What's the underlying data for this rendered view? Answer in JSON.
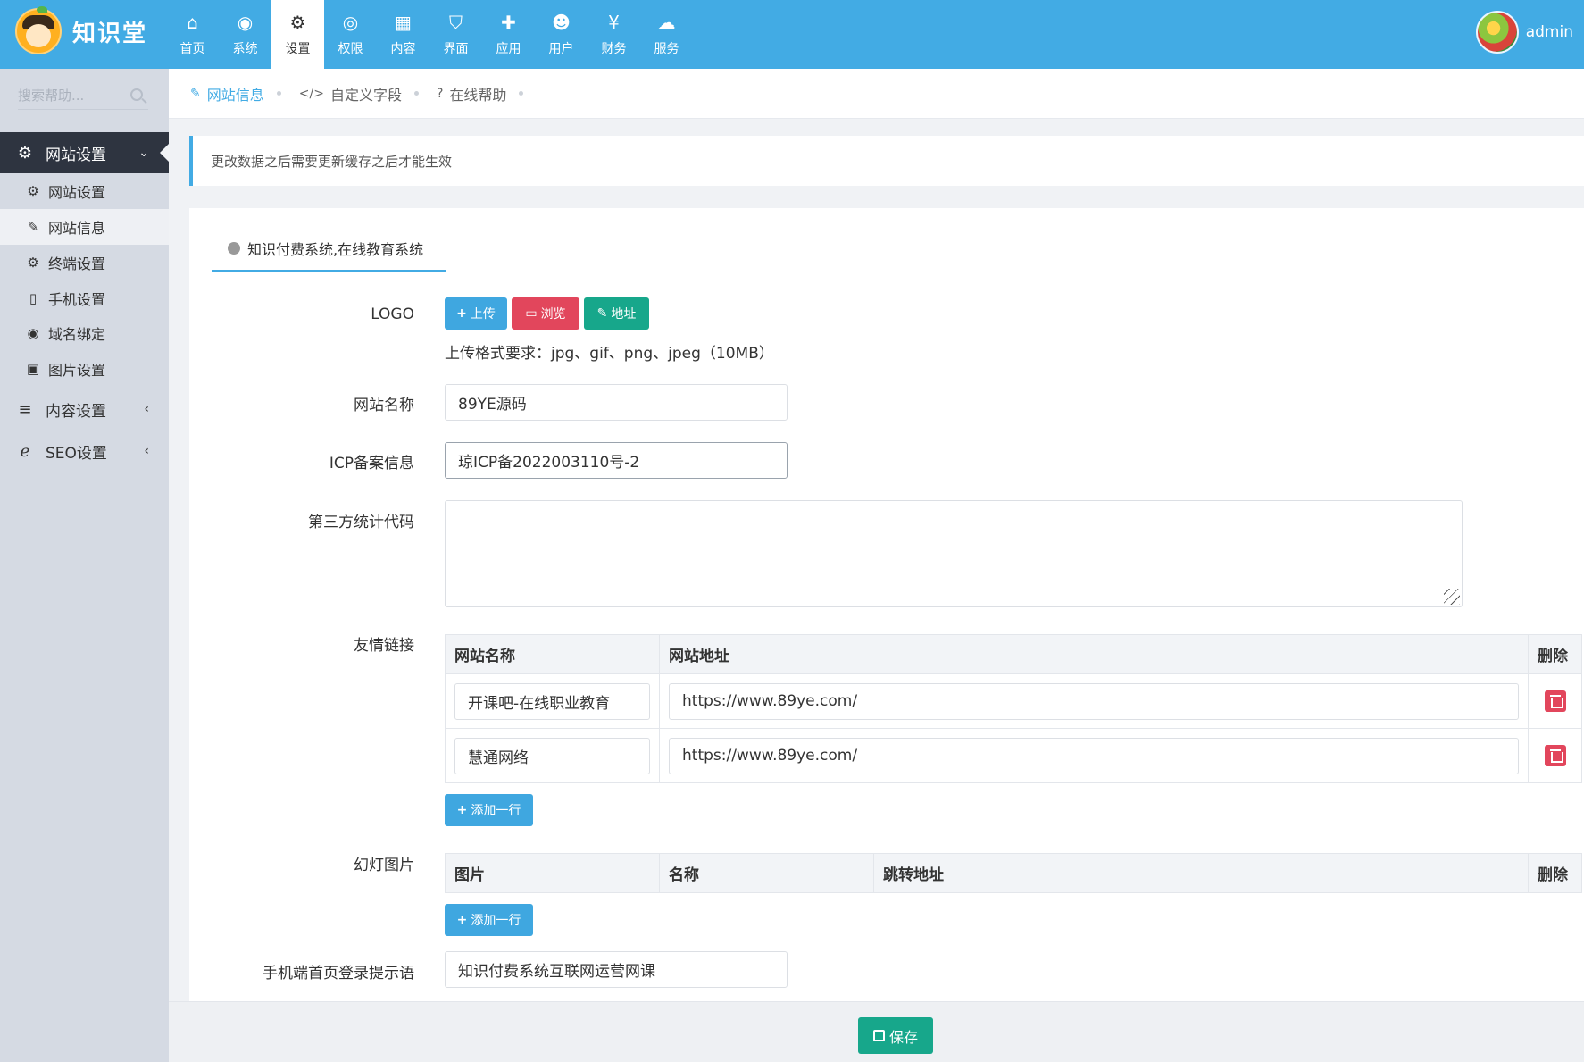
{
  "brand": {
    "name": "知识堂"
  },
  "topnav": [
    {
      "label": "首页",
      "icon": "home-icon",
      "glyph": "⌂"
    },
    {
      "label": "系统",
      "icon": "globe-icon",
      "glyph": "◉"
    },
    {
      "label": "设置",
      "icon": "gears-icon",
      "glyph": "⚙",
      "active": true
    },
    {
      "label": "权限",
      "icon": "user-circle-icon",
      "glyph": "◎"
    },
    {
      "label": "内容",
      "icon": "grid-icon",
      "glyph": "▦"
    },
    {
      "label": "界面",
      "icon": "html5-icon",
      "glyph": "⛉"
    },
    {
      "label": "应用",
      "icon": "puzzle-icon",
      "glyph": "✚"
    },
    {
      "label": "用户",
      "icon": "user-icon",
      "glyph": "☻"
    },
    {
      "label": "财务",
      "icon": "yen-icon",
      "glyph": "¥"
    },
    {
      "label": "服务",
      "icon": "cloud-icon",
      "glyph": "☁"
    }
  ],
  "user": {
    "name": "admin"
  },
  "sidebar": {
    "search_placeholder": "搜索帮助...",
    "groups": [
      {
        "label": "网站设置",
        "icon": "gear-icon",
        "glyph": "⚙",
        "chevron": "⌄"
      },
      {
        "label": "内容设置",
        "icon": "bars-icon",
        "glyph": "≡",
        "chevron": "‹"
      },
      {
        "label": "SEO设置",
        "icon": "ie-icon",
        "glyph": "ℯ",
        "chevron": "‹"
      }
    ],
    "items": [
      {
        "label": "网站设置",
        "icon": "gear-icon",
        "glyph": "⚙"
      },
      {
        "label": "网站信息",
        "icon": "edit-icon",
        "glyph": "✎"
      },
      {
        "label": "终端设置",
        "icon": "gears-icon",
        "glyph": "⚙"
      },
      {
        "label": "手机设置",
        "icon": "mobile-icon",
        "glyph": "▯"
      },
      {
        "label": "域名绑定",
        "icon": "globe-icon",
        "glyph": "◉"
      },
      {
        "label": "图片设置",
        "icon": "image-icon",
        "glyph": "▣"
      }
    ]
  },
  "crumbs": [
    {
      "label": "网站信息",
      "icon": "edit-icon",
      "glyph": "✎"
    },
    {
      "label": "自定义字段",
      "icon": "code-icon",
      "glyph": "</>"
    },
    {
      "label": "在线帮助",
      "icon": "question-icon",
      "glyph": "?"
    }
  ],
  "notice": "更改数据之后需要更新缓存之后才能生效",
  "panel_tab": "知识付费系统,在线教育系统",
  "form": {
    "logo_label": "LOGO",
    "upload_label": "上传",
    "browse_label": "浏览",
    "address_label": "地址",
    "upload_hint": "上传格式要求：jpg、gif、png、jpeg（10MB）",
    "site_name_label": "网站名称",
    "site_name_value": "89YE源码",
    "icp_label": "ICP备案信息",
    "icp_value": "琼ICP备2022003110号-2",
    "stats_label": "第三方统计代码",
    "links_label": "友情链接",
    "links_headers": [
      "网站名称",
      "网站地址",
      "删除"
    ],
    "links_rows": [
      {
        "name": "开课吧-在线职业教育",
        "url": "https://www.89ye.com/"
      },
      {
        "name": "慧通网络",
        "url": "https://www.89ye.com/"
      }
    ],
    "add_row_label": "添加一行",
    "slides_label": "幻灯图片",
    "slides_headers": [
      "图片",
      "名称",
      "跳转地址",
      "删除"
    ],
    "mobile_tip_label": "手机端首页登录提示语",
    "mobile_tip_value": "知识付费系统互联网运营网课"
  },
  "save_label": "保存"
}
